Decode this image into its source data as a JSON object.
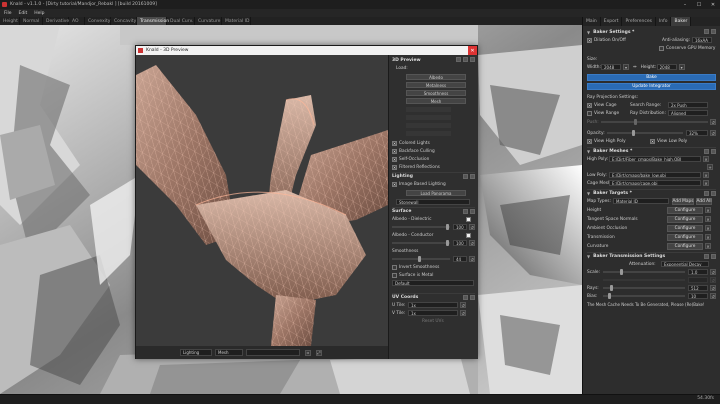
{
  "app": {
    "title": "Knald - v1.1.0 - [Dirty tutorial/Mandjor_Rebakl ] [build 20161009]",
    "menu": [
      "File",
      "Edit",
      "Help"
    ],
    "window_controls": {
      "minimize": "–",
      "maximize": "☐",
      "close": "✕"
    }
  },
  "map_tabs": [
    {
      "label": "Height",
      "active": false
    },
    {
      "label": "Normal",
      "active": false
    },
    {
      "label": "Derivative",
      "active": false
    },
    {
      "label": "AO",
      "active": false
    },
    {
      "label": "Convexity",
      "active": false
    },
    {
      "label": "Concavity",
      "active": false
    },
    {
      "label": "Transmission",
      "active": true
    },
    {
      "label": "Dual Curv.",
      "active": false
    },
    {
      "label": "Curvature",
      "active": false
    },
    {
      "label": "Material ID",
      "active": false
    }
  ],
  "right_tabs": [
    {
      "label": "Main",
      "active": false
    },
    {
      "label": "Export",
      "active": false
    },
    {
      "label": "Preferences",
      "active": false
    },
    {
      "label": "Info",
      "active": false
    },
    {
      "label": "Baker",
      "active": true
    }
  ],
  "baker_settings": {
    "header": "Baker Settings *",
    "dilation_label": "Dilation On/Off",
    "anti_aliasing_label": "Anti-aliasing:",
    "anti_aliasing_value": "16xAA",
    "conserve_gpu_label": "Conserve GPU Memory",
    "size_label": "Size:",
    "width_label": "Width:",
    "width_value": "2048",
    "height_label": "Height:",
    "height_value": "2048",
    "bake_button": "Bake",
    "update_integrator_button": "Update Integrator",
    "ray_projection_label": "Ray Projection Settings:",
    "view_cage_label": "View Cage",
    "search_range_label": "Search Range:",
    "search_range_value": "2x Push",
    "view_range_label": "View Range",
    "ray_distribution_label": "Ray Distribution:",
    "ray_distribution_value": "Aligned",
    "push_label": "Push:",
    "opacity_label": "Opacity:",
    "opacity_value": "32%",
    "opacity_fraction": 0.32,
    "view_high_poly_label": "View High Poly",
    "view_low_poly_label": "View Low Poly"
  },
  "baker_meshes": {
    "header": "Baker Meshes *",
    "high_poly_label": "High Poly: 1",
    "high_poly_value": "E:/Dirt/Fiber_cmaps/Bake_high.OBJ",
    "low_poly_label": "Low Poly:",
    "low_poly_value": "E:/Dirt/cmaps/bake_low.obj",
    "cage_mesh_label": "Cage Mesh:",
    "cage_mesh_value": "E:/Dirt/cmaps/cage.obj"
  },
  "baker_targets": {
    "header": "Baker Targets *",
    "map_types_label": "Map Types:",
    "map_types_value": "Material ID",
    "add_maps_button": "Add Maps",
    "add_all_button": "Add All",
    "configure_button": "Configure",
    "maps": [
      "Height",
      "Tangent Space Normals",
      "Ambient Occlusion",
      "Transmission",
      "Curvature"
    ]
  },
  "transmission": {
    "header": "Baker Transmission Settings",
    "attenuation_label": "Attenuation:",
    "attenuation_value": "Exponential Decay",
    "scale_label": "Scale:",
    "scale_value": "1.0",
    "rays_label": "Rays:",
    "rays_value": "512",
    "bias_label": "Bias:",
    "bias_value": "10",
    "message": "The Mesh Cache Needs To Be Generated, Please (Re)Bake!"
  },
  "dialog": {
    "title": "Knald - 3D Preview",
    "close": "✕",
    "preview_header": "3D Preview",
    "load_label": "Load:",
    "load_buttons": [
      "Albedo",
      "Metalness",
      "Smoothness",
      "Mesh"
    ],
    "options": [
      "Colored Lights",
      "Backface Culling",
      "Self-Occlusion",
      "Filtered Reflections"
    ],
    "lighting_header": "Lighting",
    "ibl_label": "Image Based Lighting",
    "load_panorama_button": "Load Panorama",
    "panorama_value": "Stonewall",
    "surface_header": "Surface",
    "albedo_dielectric_label": "Albedo - Dielectric",
    "albedo_dielectric_value": "100",
    "albedo_conductor_label": "Albedo - Conductor",
    "albedo_conductor_value": "100",
    "smoothness_label": "Smoothness",
    "smoothness_value": "44",
    "invert_smoothness_label": "Invert Smoothness",
    "surface_metal_label": "Surface is Metal",
    "surface_dropdown": "Default",
    "uv_header": "UV Coords",
    "u_tile_label": "U Tile:",
    "u_tile_value": "1x",
    "v_tile_label": "V Tile:",
    "v_tile_value": "1x",
    "reset_label": "Reset UVs",
    "bottom_lighting": "Lighting",
    "bottom_mesh": "Mesh"
  },
  "status": {
    "fps": "54.30fs"
  },
  "colors": {
    "accent": "#2a6bb5",
    "close_red": "#d33333",
    "panel": "#2d2d2d"
  }
}
